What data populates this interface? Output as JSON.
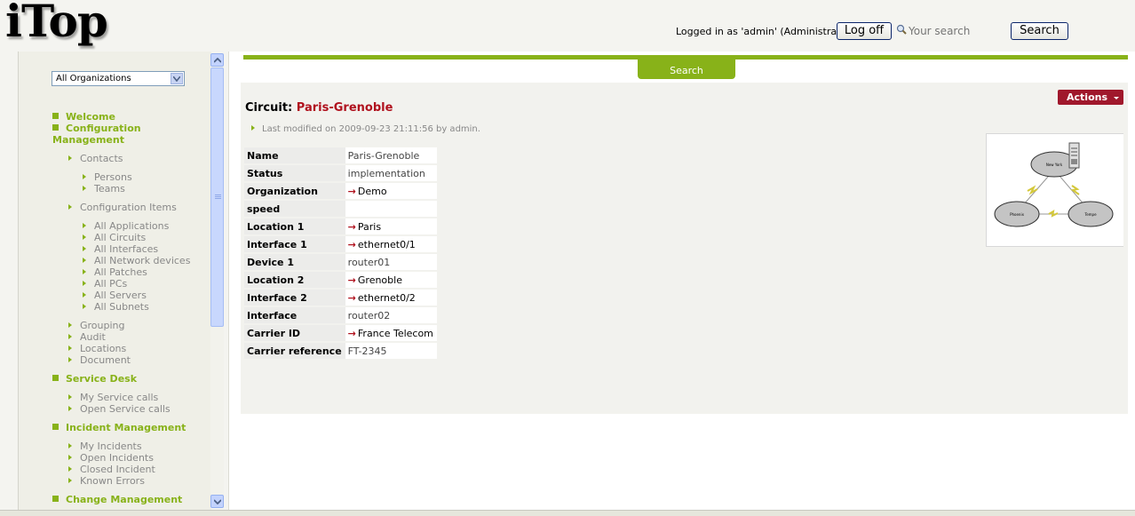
{
  "header": {
    "logo": "iTop",
    "logged_in_text": "Logged in as 'admin' (Administrator)",
    "logoff_label": "Log off",
    "search_placeholder": "Your search",
    "search_button": "Search"
  },
  "sidebar": {
    "org_select": "All Organizations",
    "welcome": "Welcome",
    "config_mgmt_line1": "Configuration",
    "config_mgmt_line2": "Management",
    "contacts": "Contacts",
    "persons": "Persons",
    "teams": "Teams",
    "config_items": "Configuration Items",
    "ci_items": [
      "All Applications",
      "All Circuits",
      "All Interfaces",
      "All Network devices",
      "All Patches",
      "All PCs",
      "All Servers",
      "All Subnets"
    ],
    "grouping": "Grouping",
    "audit": "Audit",
    "locations": "Locations",
    "document": "Document",
    "service_desk": "Service Desk",
    "my_service_calls": "My Service calls",
    "open_service_calls": "Open Service calls",
    "incident_mgmt": "Incident Management",
    "my_incidents": "My Incidents",
    "open_incidents": "Open Incidents",
    "closed_incident": "Closed Incident",
    "known_errors": "Known Errors",
    "change_mgmt": "Change Management"
  },
  "main": {
    "search_tab": "Search",
    "actions": "Actions",
    "title_prefix": "Circuit:",
    "title_name": "Paris-Grenoble",
    "modified": "Last modified on 2009-09-23 21:11:56 by admin.",
    "attributes": [
      {
        "label": "Name",
        "value": "Paris-Grenoble",
        "link": false
      },
      {
        "label": "Status",
        "value": "implementation",
        "link": false
      },
      {
        "label": "Organization",
        "value": "Demo",
        "link": true
      },
      {
        "label": "speed",
        "value": "",
        "link": false
      },
      {
        "label": "Location 1",
        "value": "Paris",
        "link": true
      },
      {
        "label": "Interface 1",
        "value": "ethernet0/1",
        "link": true
      },
      {
        "label": "Device 1",
        "value": "router01",
        "link": false
      },
      {
        "label": "Location 2",
        "value": "Grenoble",
        "link": true
      },
      {
        "label": "Interface 2",
        "value": "ethernet0/2",
        "link": true
      },
      {
        "label": "Interface",
        "value": "router02",
        "link": false
      },
      {
        "label": "Carrier ID",
        "value": "France Telecom",
        "link": true
      },
      {
        "label": "Carrier reference",
        "value": "FT-2345",
        "link": false
      }
    ],
    "diagram": {
      "node_top": "New York",
      "node_left": "Phoenix",
      "node_right": "Tempe"
    }
  },
  "colors": {
    "accent_green": "#88b219",
    "title_red": "#b0121e",
    "actions_bg": "#a0182c"
  },
  "icons": [
    "search-icon",
    "chevron-down-icon",
    "scroll-up-icon",
    "scroll-down-icon",
    "link-arrow-icon",
    "server-icon",
    "lightning-icon"
  ]
}
